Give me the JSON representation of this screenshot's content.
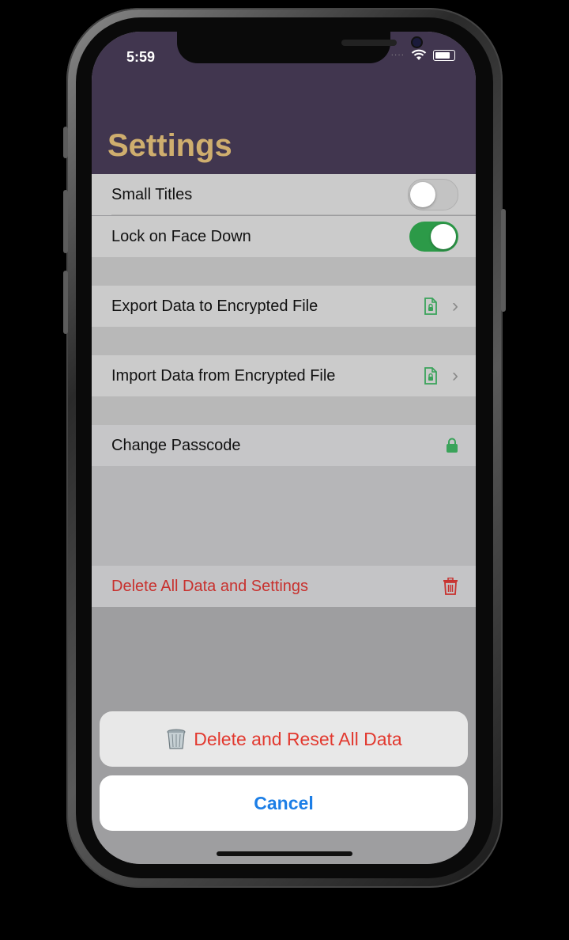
{
  "status_bar": {
    "time": "5:59"
  },
  "header": {
    "title": "Settings"
  },
  "rows": {
    "small_titles": {
      "label": "Small Titles",
      "toggle_on": false
    },
    "lock_face_down": {
      "label": "Lock on Face Down",
      "toggle_on": true
    },
    "export": {
      "label": "Export Data to Encrypted File",
      "icon": "locked-document-icon"
    },
    "import": {
      "label": "Import Data from Encrypted File",
      "icon": "locked-document-icon"
    },
    "passcode": {
      "label": "Change Passcode",
      "icon": "lock-icon"
    },
    "delete_all": {
      "label": "Delete All Data and Settings",
      "icon": "trash-icon"
    }
  },
  "action_sheet": {
    "action_label": "Delete and Reset All Data",
    "cancel_label": "Cancel"
  },
  "colors": {
    "header_bg": "#41364f",
    "title": "#cfae6e",
    "toggle_on": "#2c9a48",
    "accent_green": "#3aa35a",
    "destructive": "#c8312e",
    "link_blue": "#1c7ee6"
  }
}
